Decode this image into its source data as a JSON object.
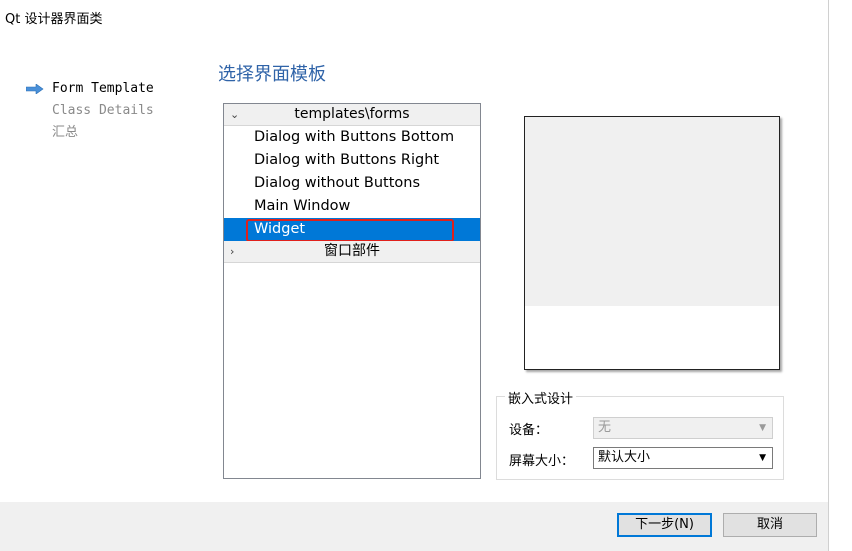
{
  "window": {
    "title": "Qt 设计器界面类"
  },
  "steps": [
    {
      "label": "Form Template",
      "active": true
    },
    {
      "label": "Class Details",
      "active": false
    },
    {
      "label": "汇总",
      "active": false
    }
  ],
  "page_heading": "选择界面模板",
  "tree": {
    "group1": {
      "label": "templates\\forms",
      "expanded": true,
      "chevron": "⌄"
    },
    "items": [
      "Dialog with Buttons Bottom",
      "Dialog with Buttons Right",
      "Dialog without Buttons",
      "Main Window",
      "Widget"
    ],
    "selected": "Widget",
    "group2": {
      "label": "窗口部件",
      "expanded": false,
      "chevron": "›"
    }
  },
  "embedded": {
    "legend": "嵌入式设计",
    "device_label": "设备：",
    "device_value": "无",
    "screen_label": "屏幕大小：",
    "screen_value": "默认大小"
  },
  "buttons": {
    "next": "下一步(N)",
    "cancel": "取消"
  },
  "colors": {
    "accent": "#0078d7",
    "highlight": "#e0201b",
    "heading": "#2f63a8"
  }
}
